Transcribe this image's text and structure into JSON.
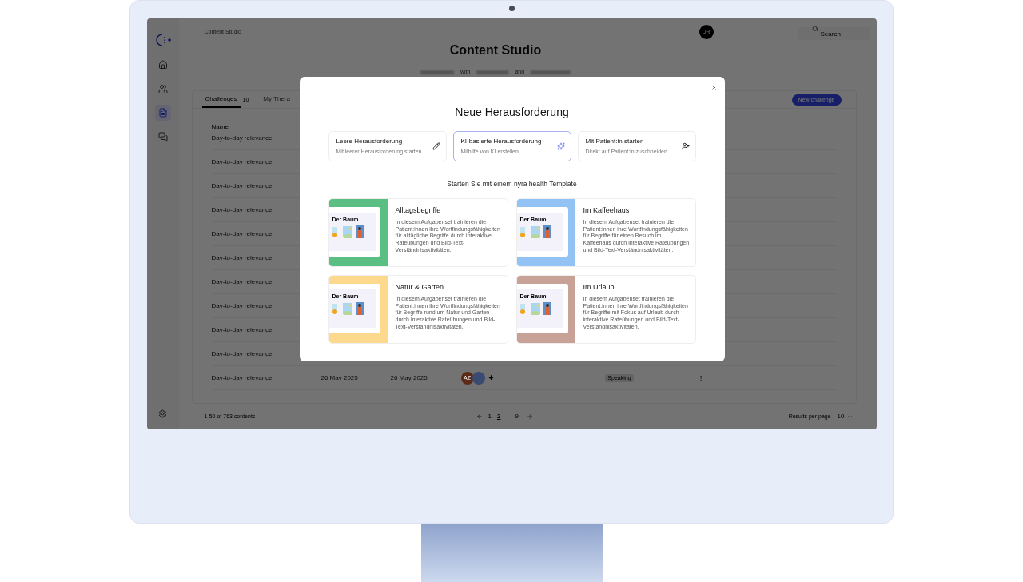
{
  "app": {
    "breadcrumb": "Content Studio",
    "avatar": "DR",
    "search": {
      "placeholder": "Search"
    },
    "title": "Content Studio",
    "subtitle": [
      "with",
      "and"
    ],
    "sidebar": [
      {
        "kind": "home",
        "selected": false
      },
      {
        "kind": "users",
        "selected": false
      },
      {
        "kind": "content",
        "selected": true
      },
      {
        "kind": "chat",
        "selected": false
      }
    ],
    "tabs": [
      {
        "label": "Challenges",
        "count": "10",
        "selected": true
      },
      {
        "label": "My Thera",
        "selected": false
      }
    ],
    "new_button": "New challenge",
    "table": {
      "columns": [
        "Name"
      ],
      "rows": [
        {
          "name": "Day-to-day relevance"
        },
        {
          "name": "Day-to-day relevance"
        },
        {
          "name": "Day-to-day relevance"
        },
        {
          "name": "Day-to-day relevance"
        },
        {
          "name": "Day-to-day relevance"
        },
        {
          "name": "Day-to-day relevance"
        },
        {
          "name": "Day-to-day relevance"
        },
        {
          "name": "Day-to-day relevance"
        },
        {
          "name": "Day-to-day relevance"
        },
        {
          "name": "Day-to-day relevance"
        },
        {
          "name": "Day-to-day relevance",
          "created": "26 May 2025",
          "updated": "26 May 2025",
          "avatars": [
            {
              "initials": "AZ",
              "color": "#5c2b18"
            },
            {
              "color": "#3a4a70"
            }
          ],
          "more": "+",
          "tag": "Speaking"
        }
      ]
    },
    "footer": {
      "count": "1-50 of 763 contents",
      "pages": [
        {
          "label": "1",
          "selected": false
        },
        {
          "label": "2",
          "selected": true
        },
        {
          "label": "9",
          "selected": false
        }
      ],
      "per_page_label": "Results per page",
      "per_page": "10"
    }
  },
  "modal": {
    "title": "Neue Herausforderung",
    "options": [
      {
        "kind": "empty",
        "title": "Leere Herausforderung",
        "subtitle": "Mit leerer Herausforderung starten",
        "selected": false
      },
      {
        "kind": "ai",
        "title": "KI-basierte Herausforderung",
        "subtitle": "Mithilfe von KI erstellen",
        "selected": true
      },
      {
        "kind": "patient",
        "title": "Mit Patient:in starten",
        "subtitle": "Direkt auf Patient:in zuschneiden",
        "selected": false
      }
    ],
    "templates_heading": "Starten Sie mit einem nyra health Template",
    "templates": [
      {
        "title": "Alltagsbegriffe",
        "description": "In diesem Aufgabenset trainieren die Patient:innen ihre Wortfindungsfähigkeiten für alltägliche Begriffe durch interaktive Rateübungen und Bild-Text-Verständnisaktivitäten.",
        "color": "#5bbf84",
        "thumbnail_title": "Der Baum"
      },
      {
        "title": "Im Kaffeehaus",
        "description": "In diesem Aufgabenset trainieren die Patient:innen ihre Wortfindungsfähigkeiten für Begriffe für einen Besuch im Kaffeehaus durch interaktive Rateübungen und Bild-Text-Verständnisaktivitäten.",
        "color": "#93c3f5",
        "thumbnail_title": "Der Baum"
      },
      {
        "title": "Natur & Garten",
        "description": "In diesem Aufgabenset trainieren die Patient:innen ihre Wortfindungsfähigkeiten für Begriffe rund um Natur und Garten durch interaktive Rateübungen und Bild-Text-Verständnisaktivitäten.",
        "color": "#fcd98c",
        "thumbnail_title": "Der Baum"
      },
      {
        "title": "Im Urlaub",
        "description": "In diesem Aufgabenset trainieren die Patient:innen ihre Wortfindungsfähigkeiten für Begriffe mit Fokus auf Urlaub durch interaktive Rateübungen und Bild-Text-Verständnisaktivitäten.",
        "color": "#c8a296",
        "thumbnail_title": "Der Baum"
      }
    ]
  }
}
